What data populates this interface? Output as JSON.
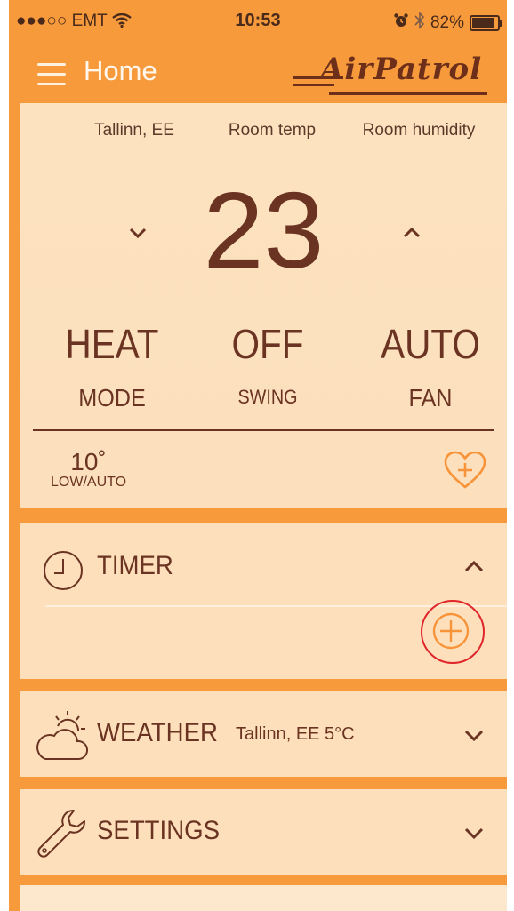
{
  "status_bar": {
    "carrier": "●●●○○ EMT",
    "time": "10:53",
    "battery": "82%"
  },
  "nav": {
    "title": "Home",
    "logo": "AirPatrol"
  },
  "climate": {
    "stats": [
      {
        "label": "Tallinn, EE"
      },
      {
        "label": "Room temp"
      },
      {
        "label": "Room humidity"
      }
    ],
    "target_temp": "23",
    "mode": {
      "value": "HEAT",
      "label": "MODE"
    },
    "swing": {
      "value": "OFF",
      "label": "SWING"
    },
    "fan": {
      "value": "AUTO",
      "label": "FAN"
    },
    "setpoint": {
      "value": "10˚",
      "label": "LOW/AUTO"
    }
  },
  "timer": {
    "title": "TIMER"
  },
  "weather": {
    "title": "WEATHER",
    "location": "Tallinn, EE 5°C"
  },
  "settings": {
    "title": "SETTINGS"
  },
  "colors": {
    "background": "#f79a3c",
    "card": "#fde0bb",
    "text": "#6b3422",
    "accent": "#f7943a",
    "highlight_ring": "#e0262a"
  }
}
